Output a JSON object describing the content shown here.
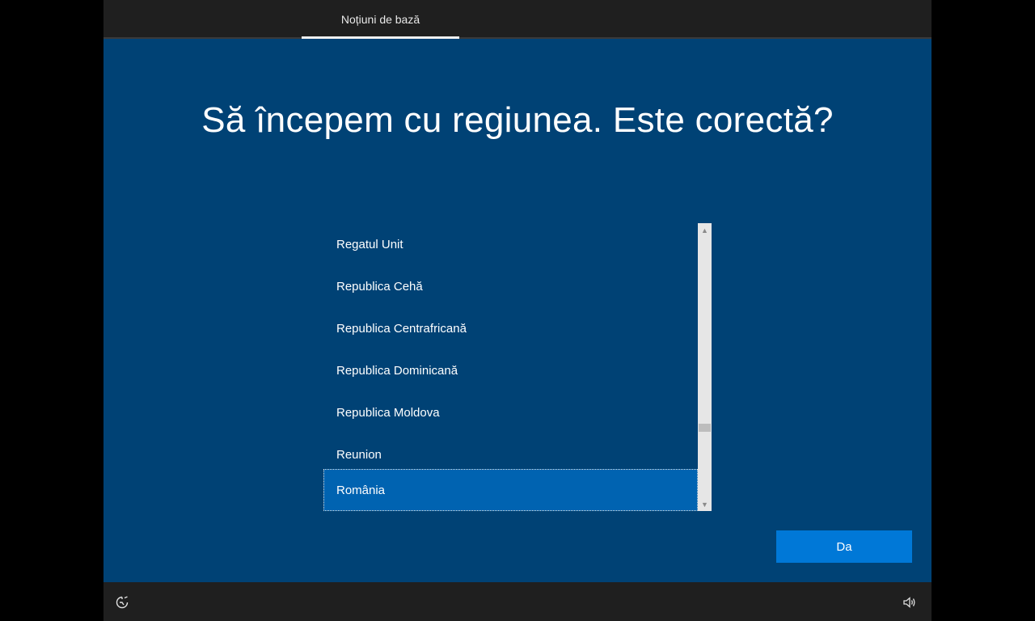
{
  "header": {
    "tab_label": "Noțiuni de bază"
  },
  "title": "Să începem cu regiunea. Este corectă?",
  "region_list": {
    "items": [
      "Regatul Unit",
      "Republica Cehă",
      "Republica Centrafricană",
      "Republica Dominicană",
      "Republica Moldova",
      "Reunion",
      "România"
    ],
    "selected": "România",
    "scroll_position": 0.74
  },
  "actions": {
    "yes_label": "Da"
  },
  "footer": {
    "left_icon": "accessibility-icon",
    "right_icon": "volume-icon"
  },
  "colors": {
    "background": "#004275",
    "selected": "#0063b1",
    "button": "#0078d7",
    "bars": "#1f1f1f"
  }
}
